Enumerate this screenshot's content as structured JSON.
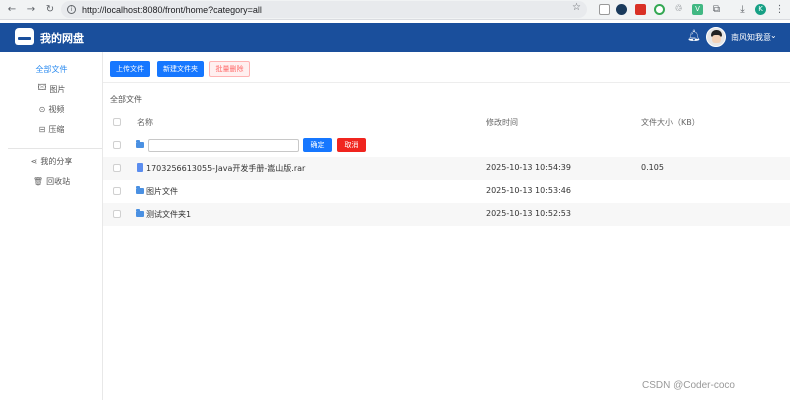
{
  "browser": {
    "url": "http://localhost:8080/front/home?category=all",
    "profile_initial": "K"
  },
  "header": {
    "title": "我的网盘",
    "username": "南风知我意"
  },
  "sidebar": {
    "items": [
      {
        "label": "全部文件",
        "icon": "all-files-icon"
      },
      {
        "label": "图片",
        "icon": "image-icon"
      },
      {
        "label": "视频",
        "icon": "video-icon"
      },
      {
        "label": "压缩",
        "icon": "archive-icon"
      }
    ],
    "secondary": [
      {
        "label": "我的分享",
        "icon": "share-icon"
      },
      {
        "label": "回收站",
        "icon": "trash-icon"
      }
    ]
  },
  "toolbar": {
    "upload_label": "上传文件",
    "new_folder_label": "新建文件夹",
    "batch_delete_label": "批量删除"
  },
  "breadcrumb": "全部文件",
  "table": {
    "columns": [
      "名称",
      "修改时间",
      "文件大小（KB）"
    ],
    "new_folder_row": {
      "input_value": "",
      "confirm_label": "确定",
      "cancel_label": "取消"
    },
    "rows": [
      {
        "type": "file",
        "name": "1703256613055-Java开发手册-嵩山版.rar",
        "modified": "2025-10-13 10:54:39",
        "size": "0.105"
      },
      {
        "type": "folder",
        "name": "图片文件",
        "modified": "2025-10-13 10:53:46",
        "size": ""
      },
      {
        "type": "folder",
        "name": "测试文件夹1",
        "modified": "2025-10-13 10:52:53",
        "size": ""
      }
    ]
  },
  "watermark": "CSDN @Coder-coco",
  "colors": {
    "header_bg": "#1a4f9c",
    "primary": "#1677ff",
    "danger": "#f0251f",
    "active_link": "#2d8cf0"
  }
}
